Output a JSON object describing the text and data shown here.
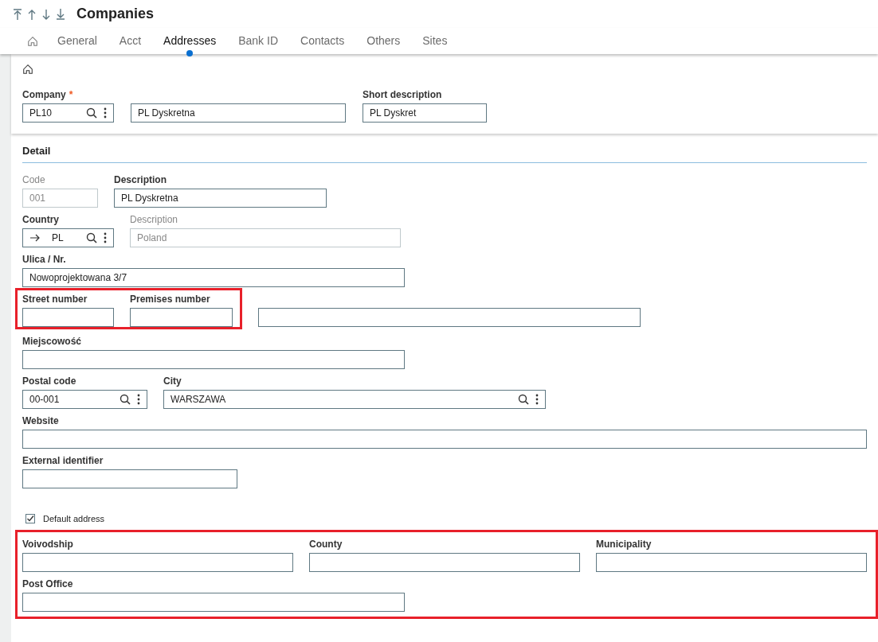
{
  "title": "Companies",
  "tabs": [
    {
      "kind": "home",
      "selected": false
    },
    {
      "label": "General",
      "selected": false
    },
    {
      "label": "Acct",
      "selected": false
    },
    {
      "label": "Addresses",
      "selected": true
    },
    {
      "label": "Bank ID",
      "selected": false
    },
    {
      "label": "Contacts",
      "selected": false
    },
    {
      "label": "Others",
      "selected": false
    },
    {
      "label": "Sites",
      "selected": false
    }
  ],
  "header": {
    "fields": [
      {
        "kind": "lookup",
        "label": "Company",
        "required_mark": "*",
        "value": "PL10",
        "disabled": false
      },
      {
        "kind": "text",
        "value": "PL Dyskretna",
        "disabled": false
      },
      {
        "kind": "text",
        "label": "Short description",
        "value": "PL Dyskret",
        "disabled": false
      }
    ]
  },
  "detail": {
    "title": "Detail",
    "blocks": [
      {
        "kind": "row",
        "items": [
          {
            "kind": "text",
            "label": "Code",
            "value": "001",
            "disabled": true
          },
          {
            "kind": "text",
            "label": "Description",
            "value": "PL Dyskretna",
            "disabled": false
          }
        ]
      },
      {
        "kind": "row",
        "items": [
          {
            "kind": "link-lookup",
            "label": "Country",
            "value": "PL",
            "disabled": false
          },
          {
            "kind": "text",
            "label": "Description",
            "value": "Poland",
            "disabled": true
          }
        ]
      },
      {
        "kind": "row",
        "items": [
          {
            "kind": "text",
            "label": "Ulica / Nr.",
            "value": "Nowoprojektowana 3/7",
            "disabled": false
          }
        ]
      },
      {
        "kind": "row",
        "items": [
          {
            "kind": "frame",
            "items": [
              {
                "kind": "text",
                "label": "Street number",
                "disabled": false
              },
              {
                "kind": "text",
                "label": "Premises number",
                "disabled": false
              }
            ]
          },
          {
            "kind": "text",
            "disabled": false
          }
        ]
      },
      {
        "kind": "row",
        "items": [
          {
            "kind": "text",
            "label": "Miejscowość",
            "disabled": false
          }
        ]
      },
      {
        "kind": "row",
        "items": [
          {
            "kind": "lookup",
            "label": "Postal code",
            "value": "00-001",
            "disabled": false
          },
          {
            "kind": "lookup",
            "label": "City",
            "value": "WARSZAWA",
            "disabled": false
          }
        ]
      },
      {
        "kind": "row",
        "items": [
          {
            "kind": "text",
            "label": "Website",
            "disabled": false
          }
        ]
      },
      {
        "kind": "row",
        "items": [
          {
            "kind": "text",
            "label": "External identifier",
            "disabled": false
          }
        ]
      },
      {
        "kind": "checkbox",
        "label": "Default address",
        "checked": true
      },
      {
        "kind": "frame",
        "rows": [
          {
            "kind": "row",
            "items": [
              {
                "kind": "text",
                "label": "Voivodship",
                "disabled": false
              },
              {
                "kind": "text",
                "label": "County",
                "disabled": false
              },
              {
                "kind": "text",
                "label": "Municipality",
                "disabled": false
              }
            ]
          },
          {
            "kind": "row",
            "items": [
              {
                "kind": "text",
                "label": "Post Office",
                "disabled": false
              }
            ]
          }
        ]
      }
    ]
  }
}
